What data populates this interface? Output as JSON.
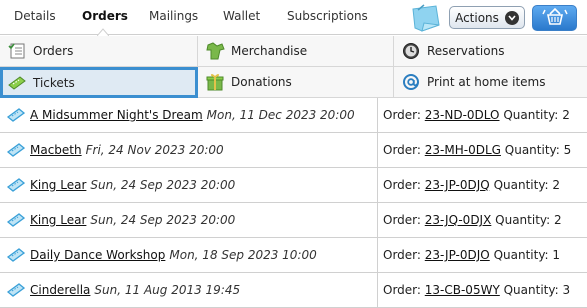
{
  "tabs": [
    {
      "label": "Details",
      "active": false
    },
    {
      "label": "Orders",
      "active": true
    },
    {
      "label": "Mailings",
      "active": false
    },
    {
      "label": "Wallet",
      "active": false
    },
    {
      "label": "Subscriptions",
      "active": false
    }
  ],
  "toolbar": {
    "actions_label": "Actions",
    "basket_icon": "basket-icon",
    "note_icon": "sticky-note-icon"
  },
  "categories": [
    {
      "label": "Orders",
      "icon": "orders-list-icon"
    },
    {
      "label": "Merchandise",
      "icon": "merchandise-icon"
    },
    {
      "label": "Reservations",
      "icon": "clock-icon"
    },
    {
      "label": "Tickets",
      "icon": "ticket-icon",
      "selected": true
    },
    {
      "label": "Donations",
      "icon": "gift-icon"
    },
    {
      "label": "Print at home items",
      "icon": "at-sign-icon"
    }
  ],
  "order_prefix": "Order:",
  "quantity_prefix": "Quantity:",
  "tickets": [
    {
      "title": "A Midsummer Night's Dream",
      "date": "Mon, 11 Dec 2023 20:00",
      "order": "23-ND-0DLO",
      "quantity": "2"
    },
    {
      "title": "Macbeth",
      "date": "Fri, 24 Nov 2023 20:00",
      "order": "23-MH-0DLG",
      "quantity": "5"
    },
    {
      "title": "King Lear",
      "date": "Sun, 24 Sep 2023 20:00",
      "order": "23-JP-0DJQ",
      "quantity": "2"
    },
    {
      "title": "King Lear",
      "date": "Sun, 24 Sep 2023 20:00",
      "order": "23-JQ-0DJX",
      "quantity": "2"
    },
    {
      "title": "Daily Dance Workshop",
      "date": "Mon, 18 Sep 2023 10:00",
      "order": "23-JP-0DJO",
      "quantity": "1"
    },
    {
      "title": "Cinderella",
      "date": "Sun, 11 Aug 2013 19:45",
      "order": "13-CB-05WY",
      "quantity": "3"
    }
  ],
  "colors": {
    "accent": "#3b8fd0",
    "ticket_icon": "#3aa0d8",
    "basket_button": "#2a79cc"
  }
}
